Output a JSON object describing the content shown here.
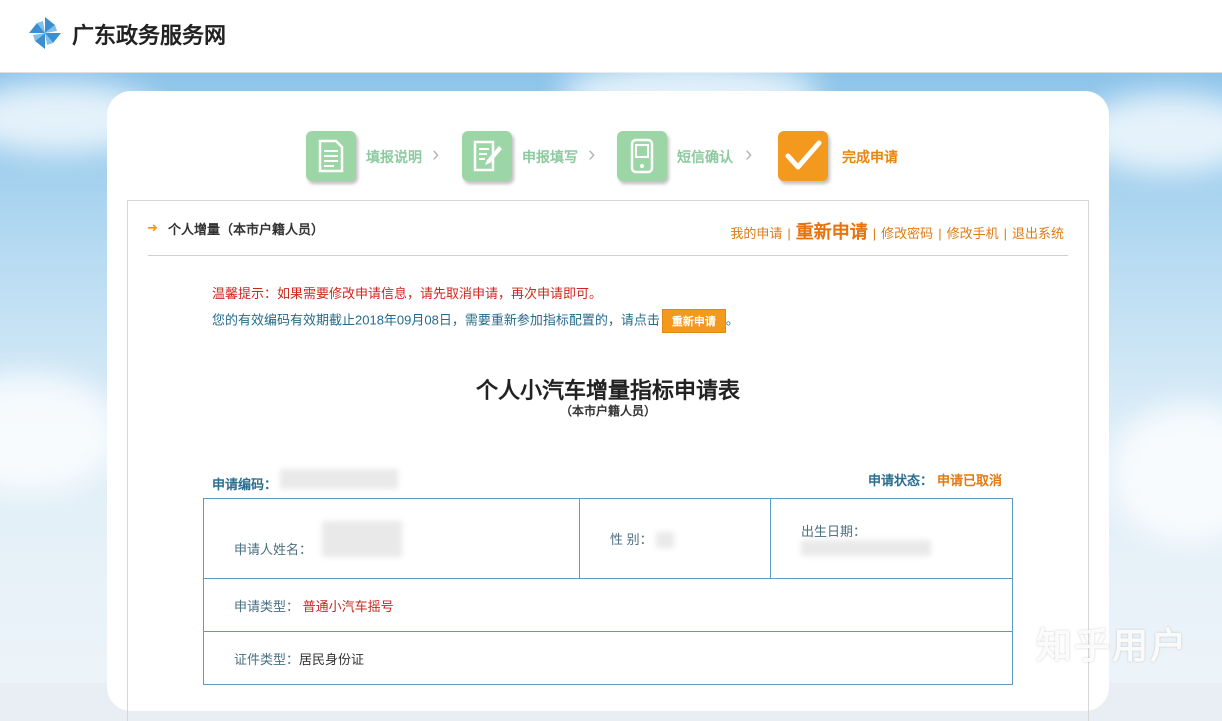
{
  "site": {
    "name": "广东政务服务网",
    "icon": "pinwheel-icon"
  },
  "steps": [
    {
      "label": "填报说明",
      "icon": "document-icon",
      "state": "done",
      "color": "#9dd6a6",
      "text_color": "#8ccaa0"
    },
    {
      "label": "申报填写",
      "icon": "edit-form-icon",
      "state": "done",
      "color": "#9dd6a6",
      "text_color": "#8ccaa0"
    },
    {
      "label": "短信确认",
      "icon": "phone-icon",
      "state": "done",
      "color": "#9dd6a6",
      "text_color": "#8ccaa0"
    },
    {
      "label": "完成申请",
      "icon": "checkmark-icon",
      "state": "active",
      "color": "#f39a1e",
      "text_color": "#e8860f"
    }
  ],
  "header": {
    "title": "个人增量（本市户籍人员）",
    "links": {
      "my_apply": "我的申请",
      "reapply": "重新申请",
      "change_password": "修改密码",
      "change_phone": "修改手机",
      "logout": "退出系统"
    }
  },
  "notice": {
    "tip": "温馨提示：如果需要修改申请信息，请先取消申请，再次申请即可。",
    "expiry_text": "您的有效编码有效期截止2018年09月08日，需要重新参加指标配置的，请点击",
    "button": "重新申请",
    "tail": "。"
  },
  "form": {
    "title": "个人小汽车增量指标申请表",
    "subtitle": "（本市户籍人员）",
    "code_label": "申请编码：",
    "status_label": "申请状态：",
    "status_value": "申请已取消",
    "name_label": "申请人姓名：",
    "gender_label": "性 别：",
    "birth_label": "出生日期：",
    "type_label": "申请类型：",
    "type_value": "普通小汽车摇号",
    "id_label": "证件类型：",
    "id_value": "居民身份证"
  },
  "watermark": "知乎用户",
  "colors": {
    "accent": "#e8720c",
    "table_border": "#5a9dc4",
    "alert": "#d0261d"
  }
}
